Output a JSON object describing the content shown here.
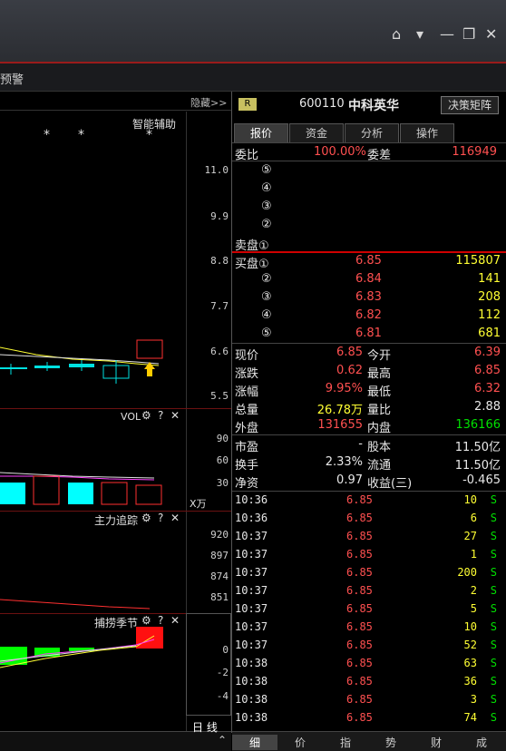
{
  "menu": {
    "label": "预警"
  },
  "chart": {
    "hide_label": "隐藏>>",
    "assist_label": "智能辅助",
    "price_axis": [
      "11.0",
      "9.9",
      "8.8",
      "7.7",
      "6.6",
      "5.5"
    ],
    "vol_title": "VOL",
    "vol_axis": [
      "90",
      "60",
      "30"
    ],
    "vol_unit": "X万",
    "main_title": "主力追踪",
    "main_axis": [
      "920",
      "897",
      "874",
      "851"
    ],
    "season_title": "捕捞季节",
    "season_axis": [
      "0",
      "-2",
      "-4"
    ],
    "period_label": "日 线",
    "stars": [
      "*",
      "*",
      "*"
    ]
  },
  "quote": {
    "r_badge": "R",
    "code": "600110",
    "name": "中科英华",
    "decision_button": "决策矩阵",
    "tabs": [
      "报价",
      "资金",
      "分析",
      "操作"
    ],
    "webi_label": "委比",
    "webi_value": "100.00%",
    "weicha_label": "委差",
    "weicha_value": "116949",
    "sell": [
      {
        "label": "⑤",
        "price": "",
        "vol": ""
      },
      {
        "label": "④",
        "price": "",
        "vol": ""
      },
      {
        "label": "③",
        "price": "",
        "vol": ""
      },
      {
        "label": "②",
        "price": "",
        "vol": ""
      },
      {
        "label": "卖盘①",
        "price": "",
        "vol": ""
      }
    ],
    "buy": [
      {
        "label": "买盘①",
        "price": "6.85",
        "vol": "115807"
      },
      {
        "label": "②",
        "price": "6.84",
        "vol": "141"
      },
      {
        "label": "③",
        "price": "6.83",
        "vol": "208"
      },
      {
        "label": "④",
        "price": "6.82",
        "vol": "112"
      },
      {
        "label": "⑤",
        "price": "6.81",
        "vol": "681"
      }
    ],
    "stats": [
      {
        "l1": "现价",
        "v1": "6.85",
        "l2": "今开",
        "v2": "6.39"
      },
      {
        "l1": "涨跌",
        "v1": "0.62",
        "l2": "最高",
        "v2": "6.85"
      },
      {
        "l1": "涨幅",
        "v1": "9.95%",
        "l2": "最低",
        "v2": "6.32"
      },
      {
        "l1": "总量",
        "v1": "26.78万",
        "l2": "量比",
        "v2": "2.88"
      },
      {
        "l1": "外盘",
        "v1": "131655",
        "l2": "内盘",
        "v2": "136166"
      }
    ],
    "stats2": [
      {
        "l1": "市盈",
        "v1": "-",
        "l2": "股本",
        "v2": "11.50亿"
      },
      {
        "l1": "换手",
        "v1": "2.33%",
        "l2": "流通",
        "v2": "11.50亿"
      },
      {
        "l1": "净资",
        "v1": "0.97",
        "l2": "收益(三)",
        "v2": "-0.465"
      }
    ],
    "trades": [
      {
        "t": "10:36",
        "p": "6.85",
        "v": "10",
        "s": "S"
      },
      {
        "t": "10:36",
        "p": "6.85",
        "v": "6",
        "s": "S"
      },
      {
        "t": "10:37",
        "p": "6.85",
        "v": "27",
        "s": "S"
      },
      {
        "t": "10:37",
        "p": "6.85",
        "v": "1",
        "s": "S"
      },
      {
        "t": "10:37",
        "p": "6.85",
        "v": "200",
        "s": "S"
      },
      {
        "t": "10:37",
        "p": "6.85",
        "v": "2",
        "s": "S"
      },
      {
        "t": "10:37",
        "p": "6.85",
        "v": "5",
        "s": "S"
      },
      {
        "t": "10:37",
        "p": "6.85",
        "v": "10",
        "s": "S"
      },
      {
        "t": "10:37",
        "p": "6.85",
        "v": "52",
        "s": "S"
      },
      {
        "t": "10:38",
        "p": "6.85",
        "v": "63",
        "s": "S"
      },
      {
        "t": "10:38",
        "p": "6.85",
        "v": "36",
        "s": "S"
      },
      {
        "t": "10:38",
        "p": "6.85",
        "v": "3",
        "s": "S"
      },
      {
        "t": "10:38",
        "p": "6.85",
        "v": "74",
        "s": "S"
      }
    ],
    "bottom_tabs": [
      "细",
      "价",
      "指",
      "势",
      "财",
      "成"
    ]
  },
  "colors": {
    "up": "#ff5050",
    "down": "#00e0e0",
    "accent": "#d00000"
  }
}
